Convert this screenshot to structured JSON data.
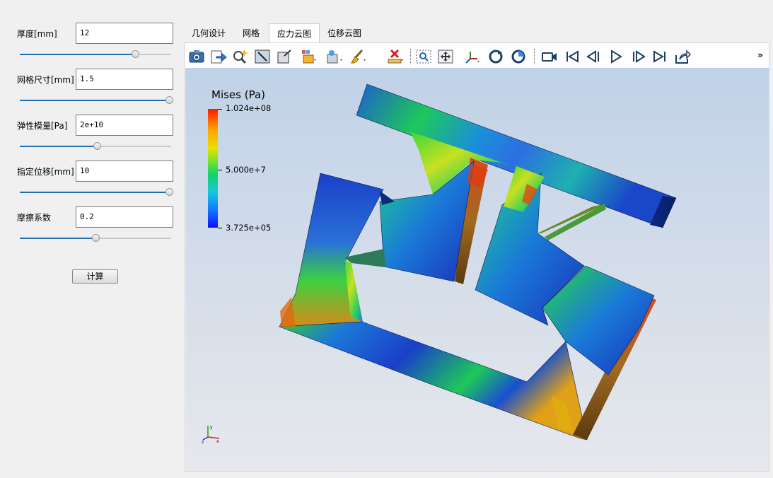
{
  "params": [
    {
      "label": "厚度[mm]",
      "value": "12",
      "slider": 0.77
    },
    {
      "label": "网格尺寸[mm]",
      "value": "1.5",
      "slider": 1.0
    },
    {
      "label": "弹性模量[Pa]",
      "value": "2e+10",
      "slider": 0.51
    },
    {
      "label": "指定位移[mm]",
      "value": "10",
      "slider": 1.0
    },
    {
      "label": "摩擦系数",
      "value": "0.2",
      "slider": 0.5
    }
  ],
  "calculate_label": "计算",
  "tabs": [
    {
      "label": "几何设计",
      "active": false
    },
    {
      "label": "网格",
      "active": false
    },
    {
      "label": "应力云图",
      "active": true
    },
    {
      "label": "位移云图",
      "active": false
    }
  ],
  "toolbar": {
    "icons": [
      "camera-icon",
      "export-icon",
      "zoom-magic-icon",
      "frame-fit-icon",
      "box-view-icon",
      "color-map-icon",
      "light-icon",
      "brush-icon",
      "ruler-delete-icon",
      "zoom-box-icon",
      "pan-icon",
      "axes-icon",
      "rotate-icon",
      "reset-view-icon",
      "video-icon",
      "first-frame-icon",
      "previous-frame-icon",
      "play-icon",
      "next-frame-icon",
      "last-frame-icon",
      "share-icon"
    ],
    "overflow": "»"
  },
  "legend": {
    "title": "Mises (Pa)",
    "max": "1.024e+08",
    "mid": "5.000e+7",
    "min": "3.725e+05"
  },
  "axes": {
    "x": "x",
    "y": "y",
    "z": "z"
  }
}
